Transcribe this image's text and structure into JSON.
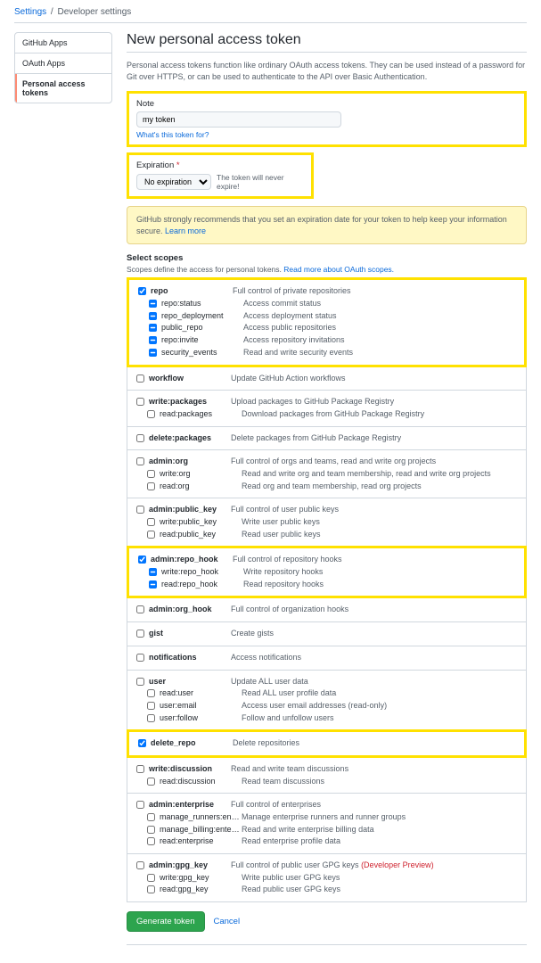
{
  "breadcrumb": {
    "settings": "Settings",
    "current": "Developer settings"
  },
  "sidebar": {
    "items": [
      "GitHub Apps",
      "OAuth Apps",
      "Personal access tokens"
    ],
    "active_index": 2
  },
  "title": "New personal access token",
  "description": "Personal access tokens function like ordinary OAuth access tokens. They can be used instead of a password for Git over HTTPS, or can be used to authenticate to the API over Basic Authentication.",
  "note": {
    "label": "Note",
    "value": "my token",
    "hint": "What's this token for?"
  },
  "expiration": {
    "label": "Expiration",
    "selected": "No expiration",
    "text": "The token will never expire!"
  },
  "flash": {
    "text": "GitHub strongly recommends that you set an expiration date for your token to help keep your information secure. ",
    "link": "Learn more"
  },
  "scopes_section": {
    "heading": "Select scopes",
    "desc_prefix": "Scopes define the access for personal tokens. ",
    "desc_link": "Read more about OAuth scopes."
  },
  "scope_groups": [
    {
      "highlight": true,
      "rows": [
        {
          "name": "repo",
          "desc": "Full control of private repositories",
          "checked": true,
          "parent": true
        },
        {
          "name": "repo:status",
          "desc": "Access commit status",
          "checked": true,
          "indeterminate": true,
          "child": true
        },
        {
          "name": "repo_deployment",
          "desc": "Access deployment status",
          "checked": true,
          "indeterminate": true,
          "child": true
        },
        {
          "name": "public_repo",
          "desc": "Access public repositories",
          "checked": true,
          "indeterminate": true,
          "child": true
        },
        {
          "name": "repo:invite",
          "desc": "Access repository invitations",
          "checked": true,
          "indeterminate": true,
          "child": true
        },
        {
          "name": "security_events",
          "desc": "Read and write security events",
          "checked": true,
          "indeterminate": true,
          "child": true
        }
      ]
    },
    {
      "rows": [
        {
          "name": "workflow",
          "desc": "Update GitHub Action workflows",
          "checked": false,
          "parent": true
        }
      ]
    },
    {
      "rows": [
        {
          "name": "write:packages",
          "desc": "Upload packages to GitHub Package Registry",
          "checked": false,
          "parent": true
        },
        {
          "name": "read:packages",
          "desc": "Download packages from GitHub Package Registry",
          "checked": false,
          "child": true
        }
      ]
    },
    {
      "rows": [
        {
          "name": "delete:packages",
          "desc": "Delete packages from GitHub Package Registry",
          "checked": false,
          "parent": true
        }
      ]
    },
    {
      "rows": [
        {
          "name": "admin:org",
          "desc": "Full control of orgs and teams, read and write org projects",
          "checked": false,
          "parent": true
        },
        {
          "name": "write:org",
          "desc": "Read and write org and team membership, read and write org projects",
          "checked": false,
          "child": true
        },
        {
          "name": "read:org",
          "desc": "Read org and team membership, read org projects",
          "checked": false,
          "child": true
        }
      ]
    },
    {
      "rows": [
        {
          "name": "admin:public_key",
          "desc": "Full control of user public keys",
          "checked": false,
          "parent": true
        },
        {
          "name": "write:public_key",
          "desc": "Write user public keys",
          "checked": false,
          "child": true
        },
        {
          "name": "read:public_key",
          "desc": "Read user public keys",
          "checked": false,
          "child": true
        }
      ]
    },
    {
      "highlight": true,
      "rows": [
        {
          "name": "admin:repo_hook",
          "desc": "Full control of repository hooks",
          "checked": true,
          "parent": true
        },
        {
          "name": "write:repo_hook",
          "desc": "Write repository hooks",
          "checked": true,
          "indeterminate": true,
          "child": true
        },
        {
          "name": "read:repo_hook",
          "desc": "Read repository hooks",
          "checked": true,
          "indeterminate": true,
          "child": true
        }
      ]
    },
    {
      "rows": [
        {
          "name": "admin:org_hook",
          "desc": "Full control of organization hooks",
          "checked": false,
          "parent": true
        }
      ]
    },
    {
      "rows": [
        {
          "name": "gist",
          "desc": "Create gists",
          "checked": false,
          "parent": true
        }
      ]
    },
    {
      "rows": [
        {
          "name": "notifications",
          "desc": "Access notifications",
          "checked": false,
          "parent": true
        }
      ]
    },
    {
      "rows": [
        {
          "name": "user",
          "desc": "Update ALL user data",
          "checked": false,
          "parent": true
        },
        {
          "name": "read:user",
          "desc": "Read ALL user profile data",
          "checked": false,
          "child": true
        },
        {
          "name": "user:email",
          "desc": "Access user email addresses (read-only)",
          "checked": false,
          "child": true
        },
        {
          "name": "user:follow",
          "desc": "Follow and unfollow users",
          "checked": false,
          "child": true
        }
      ]
    },
    {
      "highlight": true,
      "rows": [
        {
          "name": "delete_repo",
          "desc": "Delete repositories",
          "checked": true,
          "parent": true
        }
      ]
    },
    {
      "rows": [
        {
          "name": "write:discussion",
          "desc": "Read and write team discussions",
          "checked": false,
          "parent": true
        },
        {
          "name": "read:discussion",
          "desc": "Read team discussions",
          "checked": false,
          "child": true
        }
      ]
    },
    {
      "rows": [
        {
          "name": "admin:enterprise",
          "desc": "Full control of enterprises",
          "checked": false,
          "parent": true
        },
        {
          "name": "manage_runners:enterprise",
          "desc": "Manage enterprise runners and runner groups",
          "checked": false,
          "child": true
        },
        {
          "name": "manage_billing:enterprise",
          "desc": "Read and write enterprise billing data",
          "checked": false,
          "child": true
        },
        {
          "name": "read:enterprise",
          "desc": "Read enterprise profile data",
          "checked": false,
          "child": true
        }
      ]
    },
    {
      "rows": [
        {
          "name": "admin:gpg_key",
          "desc": "Full control of public user GPG keys ",
          "preview": "(Developer Preview)",
          "checked": false,
          "parent": true
        },
        {
          "name": "write:gpg_key",
          "desc": "Write public user GPG keys",
          "checked": false,
          "child": true
        },
        {
          "name": "read:gpg_key",
          "desc": "Read public user GPG keys",
          "checked": false,
          "child": true
        }
      ]
    }
  ],
  "actions": {
    "generate": "Generate token",
    "cancel": "Cancel"
  }
}
